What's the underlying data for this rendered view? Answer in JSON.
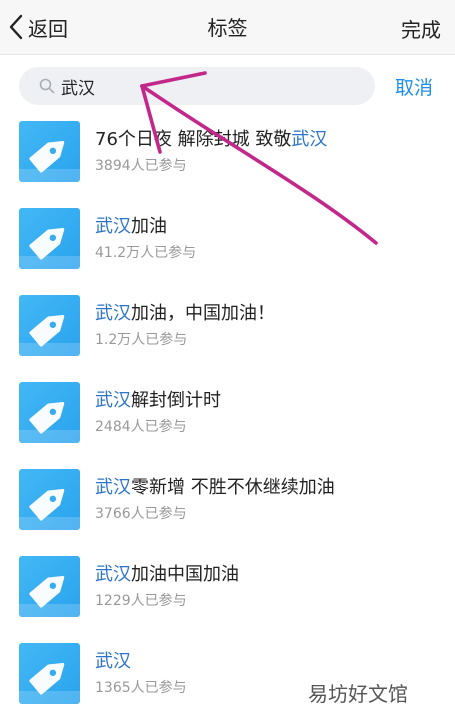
{
  "header": {
    "back_label": "返回",
    "title": "标签",
    "done_label": "完成"
  },
  "search": {
    "value": "武汉",
    "cancel_label": "取消"
  },
  "tags": [
    {
      "prefix": "76个日夜 解除封城 致敬",
      "highlight": "武汉",
      "suffix": "",
      "count": "3894人已参与"
    },
    {
      "prefix": "",
      "highlight": "武汉",
      "suffix": "加油",
      "count": "41.2万人已参与"
    },
    {
      "prefix": "",
      "highlight": "武汉",
      "suffix": "加油，中国加油！",
      "count": "1.2万人已参与"
    },
    {
      "prefix": "",
      "highlight": "武汉",
      "suffix": "解封倒计时",
      "count": "2484人已参与"
    },
    {
      "prefix": "",
      "highlight": "武汉",
      "suffix": "零新增 不胜不休继续加油",
      "count": "3766人已参与"
    },
    {
      "prefix": "",
      "highlight": "武汉",
      "suffix": "加油中国加油",
      "count": "1229人已参与"
    },
    {
      "prefix": "",
      "highlight": "武汉",
      "suffix": "",
      "count": "1365人已参与"
    }
  ],
  "watermark": "易坊好文馆",
  "colors": {
    "accent": "#1e8ff0",
    "highlight": "#2c74c8",
    "tag_thumb": "#3cb0f2",
    "arrow": "#c2288a"
  }
}
